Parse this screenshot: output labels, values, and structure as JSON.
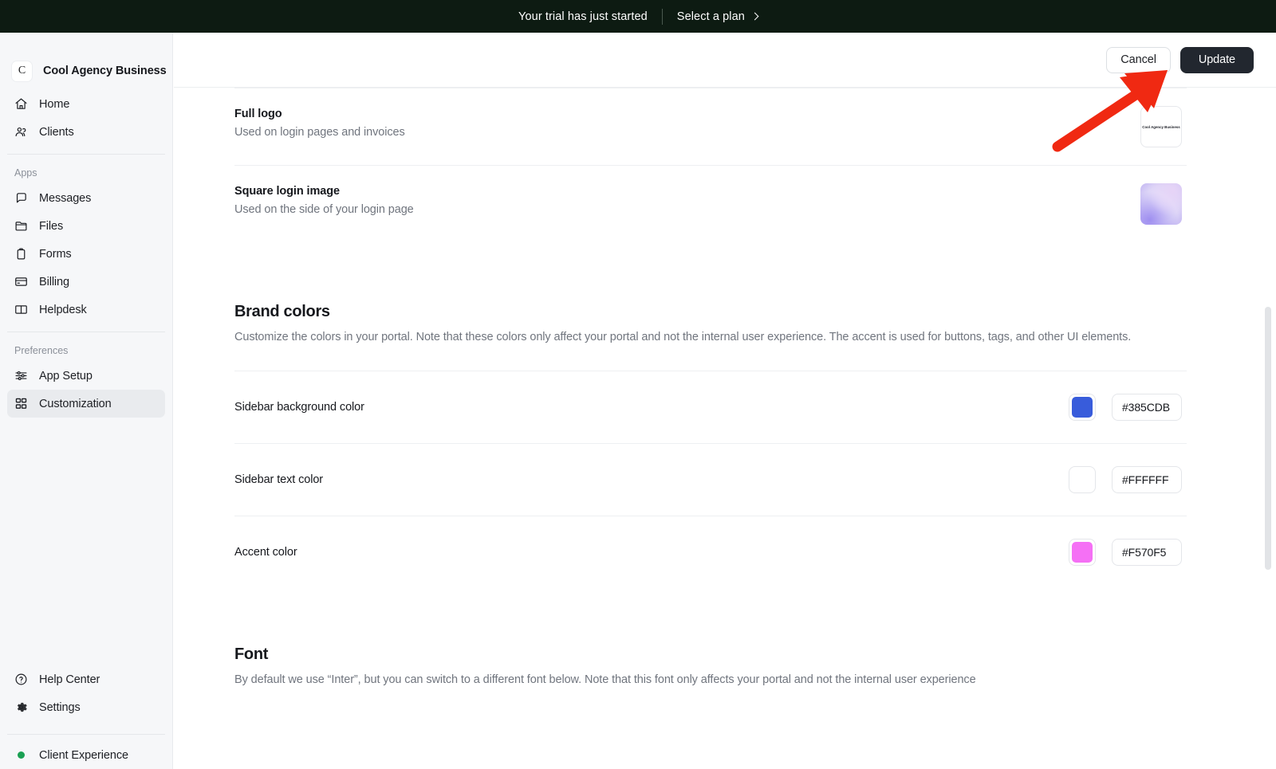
{
  "banner": {
    "message": "Your trial has just started",
    "cta_label": "Select a plan",
    "chevron_icon": "chevron-right-icon"
  },
  "sidebar": {
    "workspace_initial": "C",
    "workspace_name": "Cool Agency Business",
    "primary_items": [
      {
        "label": "Home",
        "icon": "home-icon"
      },
      {
        "label": "Clients",
        "icon": "users-icon"
      }
    ],
    "apps_group_label": "Apps",
    "apps_items": [
      {
        "label": "Messages",
        "icon": "chat-bubble-icon"
      },
      {
        "label": "Files",
        "icon": "folder-icon"
      },
      {
        "label": "Forms",
        "icon": "clipboard-icon"
      },
      {
        "label": "Billing",
        "icon": "credit-card-icon"
      },
      {
        "label": "Helpdesk",
        "icon": "book-open-icon"
      }
    ],
    "preferences_group_label": "Preferences",
    "preferences_items": [
      {
        "label": "App Setup",
        "icon": "sliders-icon",
        "active": false
      },
      {
        "label": "Customization",
        "icon": "grid-icon",
        "active": true
      }
    ],
    "bottom_items": [
      {
        "label": "Help Center",
        "icon": "question-circle-icon"
      },
      {
        "label": "Settings",
        "icon": "gear-icon"
      }
    ],
    "client_experience": {
      "label": "Client Experience",
      "status_icon": "green-dot-icon",
      "status_color": "#1aa053"
    }
  },
  "topbar": {
    "cancel_label": "Cancel",
    "update_label": "Update"
  },
  "asset_rows": [
    {
      "title": "Full logo",
      "subtitle": "Used on login pages and invoices",
      "thumbnail_kind": "logo-wordmark",
      "thumbnail_text": "Cool Agency Business"
    },
    {
      "title": "Square login image",
      "subtitle": "Used on the side of your login page",
      "thumbnail_kind": "gradient-square",
      "thumbnail_text": ""
    }
  ],
  "brand_colors": {
    "title": "Brand colors",
    "description": "Customize the colors in your portal. Note that these colors only affect your portal and not the internal user experience. The accent is used for buttons, tags, and other UI elements.",
    "rows": [
      {
        "label": "Sidebar background color",
        "hex": "#385CDB",
        "swatch": "#385CDB"
      },
      {
        "label": "Sidebar text color",
        "hex": "#FFFFFF",
        "swatch": "#FFFFFF"
      },
      {
        "label": "Accent color",
        "hex": "#F570F5",
        "swatch": "#F570F5"
      }
    ]
  },
  "font_section": {
    "title": "Font",
    "description": "By default we use “Inter”, but you can switch to a different font below. Note that this font only affects your portal and not the internal user experience"
  },
  "annotation": {
    "arrow_color": "#F02912",
    "points_to": "update-button"
  }
}
